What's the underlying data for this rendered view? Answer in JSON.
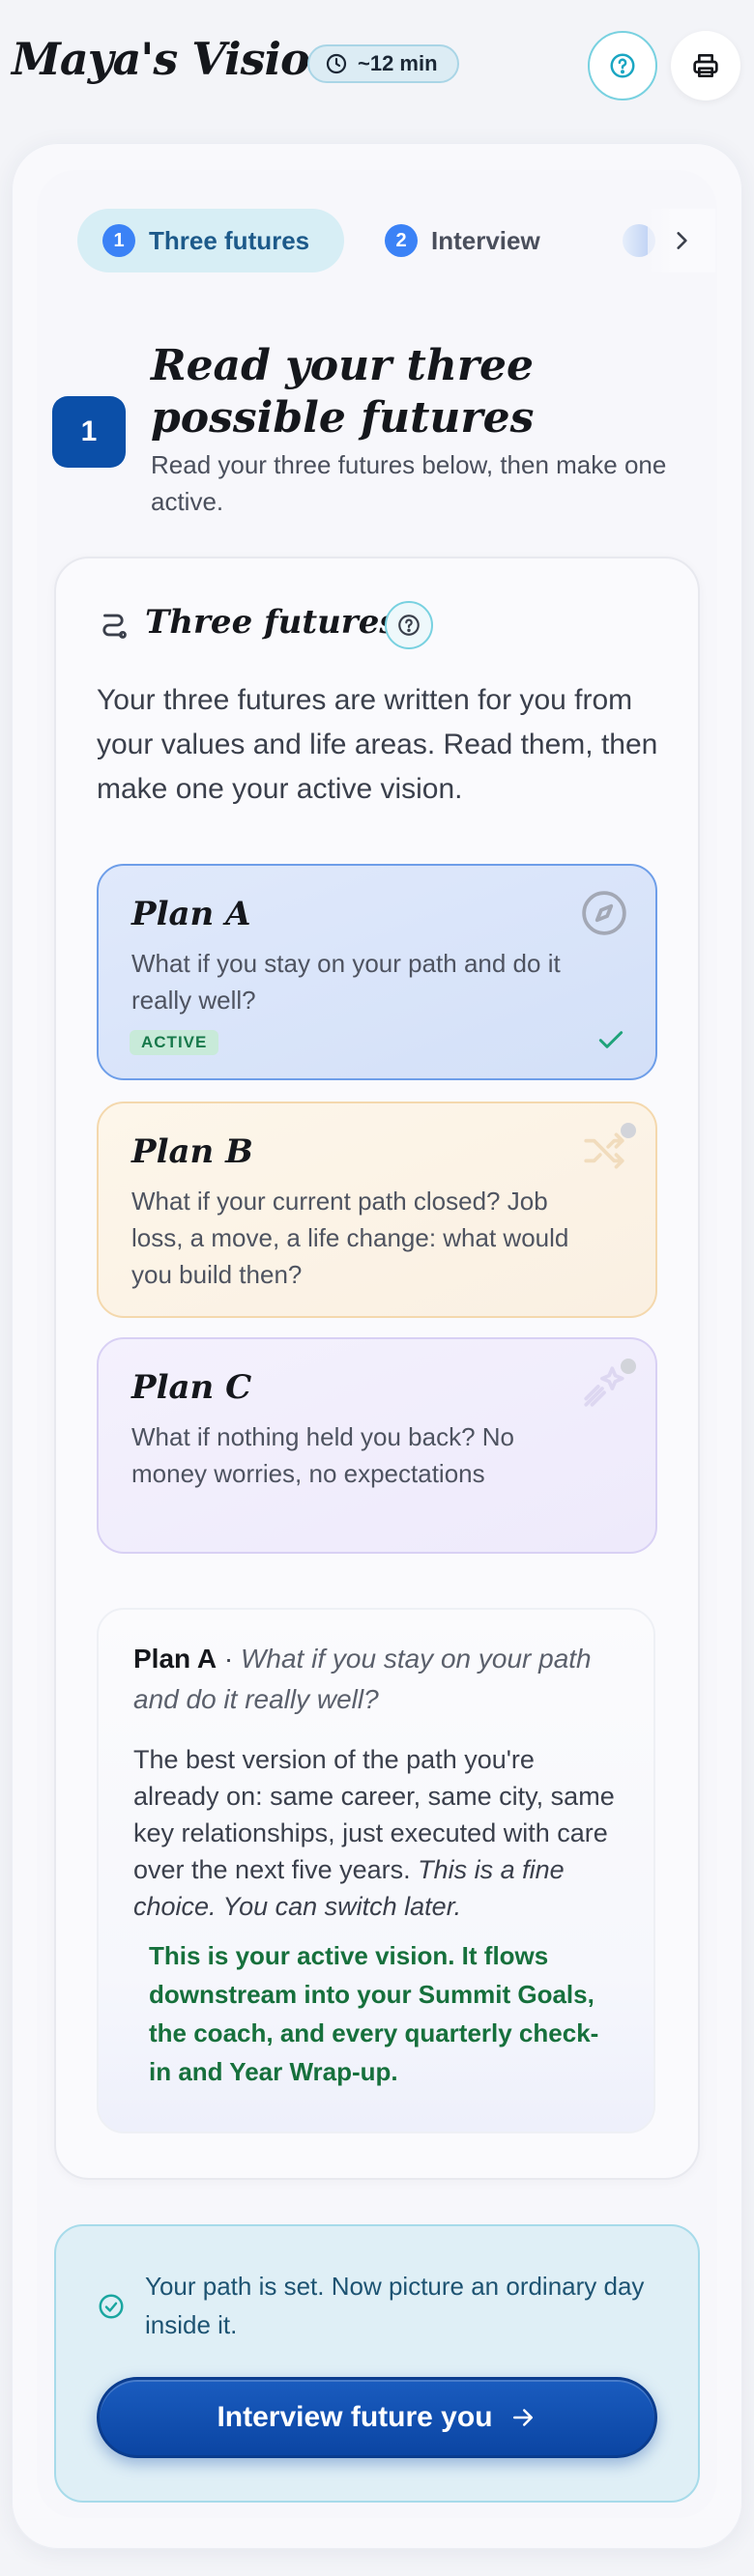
{
  "header": {
    "title": "Maya's Vision",
    "time_estimate": "~12 min",
    "help_icon": "question-circle-icon",
    "print_icon": "printer-icon"
  },
  "stepper": {
    "steps": [
      {
        "number": "1",
        "label": "Three futures",
        "active": true
      },
      {
        "number": "2",
        "label": "Interview",
        "active": false
      }
    ],
    "next_icon": "chevron-right-icon"
  },
  "section": {
    "number": "1",
    "title": "Read your three possible futures",
    "subtitle": "Read your three futures below, then make one active."
  },
  "card": {
    "title": "Three futures",
    "intro": "Your three futures are written for you from your values and life areas. Read them, then make one your active vision."
  },
  "plans": [
    {
      "title": "Plan A",
      "description": "What if you stay on your path and do it really well?",
      "badge": "ACTIVE",
      "icon": "compass-icon",
      "active": true
    },
    {
      "title": "Plan B",
      "description": "What if your current path closed? Job loss, a move, a life change: what would you build then?",
      "icon": "shuffle-icon",
      "active": false
    },
    {
      "title": "Plan C",
      "description": "What if nothing held you back? No money worries, no expectations",
      "icon": "shooting-star-icon",
      "active": false
    }
  ],
  "detail": {
    "plan_name": "Plan A",
    "separator": " · ",
    "question": "What if you stay on your path and do it really well?",
    "body": "The best version of the path you're already on: same career, same city, same key relationships, just executed with care over the next five years. ",
    "body_italic": "This is a fine choice. You can switch later.",
    "active_prefix": "This is your ",
    "active_strong": "active vision",
    "active_suffix": ". It flows downstream into your Summit Goals, the coach, and every quarterly check-in and Year Wrap-up."
  },
  "next": {
    "message": "Your path is set. Now picture an ordinary day inside it.",
    "button_label": "Interview future you"
  },
  "colors": {
    "primary": "#0b4fa8",
    "accent_teal": "#78d1e0",
    "active_green": "#16703c"
  }
}
